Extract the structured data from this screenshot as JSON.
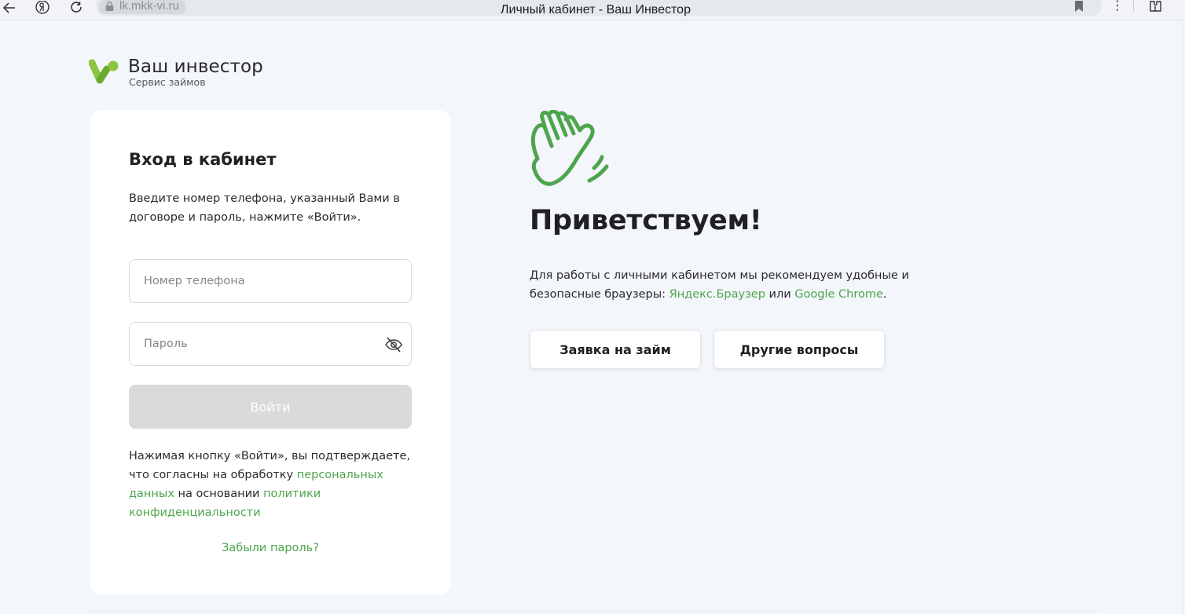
{
  "browser": {
    "url": "lk.mkk-vi.ru",
    "tab_title": "Личный кабинет - Ваш Инвестор",
    "icons": [
      "back-arrow-icon",
      "yandex-icon",
      "reload-icon",
      "lock-icon",
      "bookmark-icon",
      "more-dots-icon",
      "extensions-icon"
    ],
    "more_glyph": "⋮"
  },
  "brand": {
    "name": "Ваш инвестор",
    "subtitle": "Сервис займов",
    "colors": {
      "accent": "#4ea54e",
      "logo_green": "#8bc43f",
      "logo_dark": "#5a9e2a"
    }
  },
  "login": {
    "title": "Вход в кабинет",
    "description": "Введите номер телефона, указанный Вами в договоре и пароль, нажмите «Войти».",
    "phone_placeholder": "Номер телефона",
    "password_placeholder": "Пароль",
    "submit_label": "Войти",
    "consent": {
      "text_1": "Нажимая кнопку «Войти», вы подтверждаете, что согласны на обработку ",
      "link_personal_data": "персональных данных",
      "text_2": " на основании ",
      "link_policy": "политики конфиденциальности"
    },
    "forgot_password": "Забыли пароль?"
  },
  "welcome": {
    "heading": "Приветствуем!",
    "text_1": "Для работы с личными кабинетом мы рекомендуем удобные и безопасные браузеры: ",
    "link_yandex": "Яндекс.Браузер",
    "text_2": " или ",
    "link_chrome": "Google Chrome",
    "text_3": ".",
    "btn_apply": "Заявка на займ",
    "btn_other": "Другие вопросы"
  }
}
